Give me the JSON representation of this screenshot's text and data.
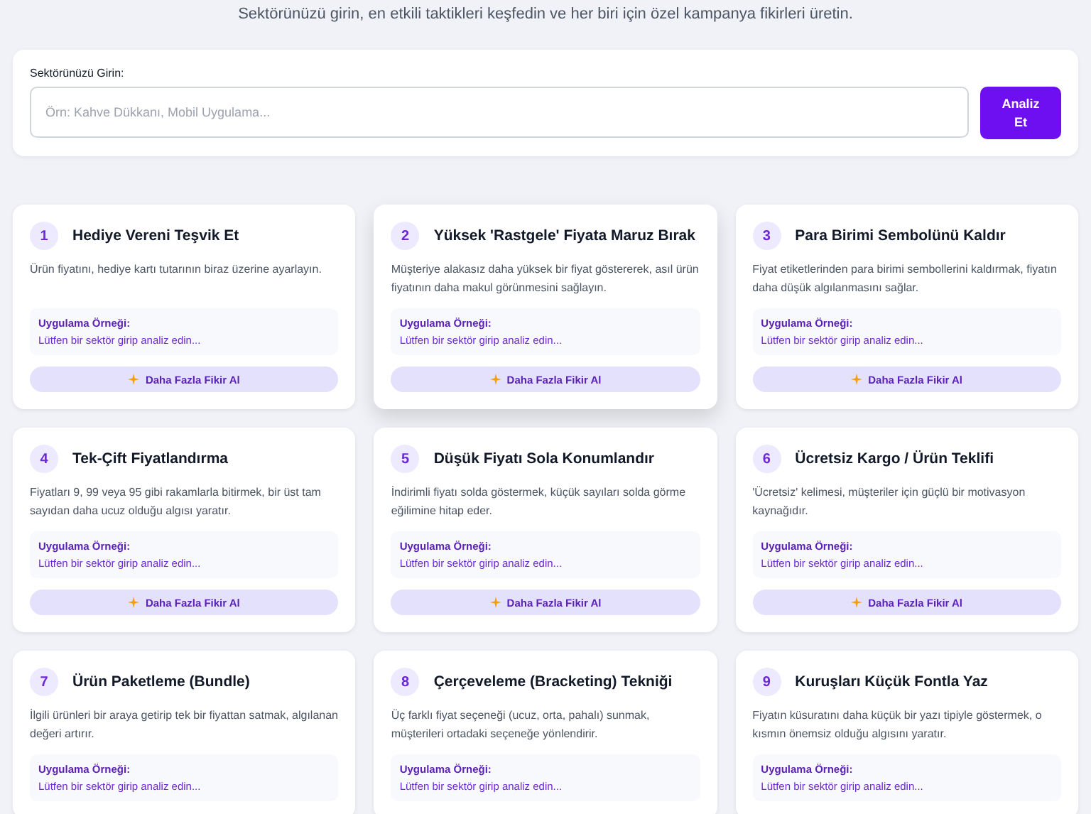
{
  "subtitle": "Sektörünüzü girin, en etkili taktikleri keşfedin ve her biri için özel kampanya fikirleri üretin.",
  "sector_form": {
    "label": "Sektörünüzü Girin:",
    "placeholder": "Örn: Kahve Dükkanı, Mobil Uygulama...",
    "button": "Analiz Et"
  },
  "tactics": [
    {
      "number": "1",
      "title": "Hediye Vereni Teşvik Et",
      "description": "Ürün fiyatını, hediye kartı tutarının biraz üzerine ayarlayın.",
      "example_label": "Uygulama Örneği:",
      "example_text": "Lütfen bir sektör girip analiz edin...",
      "button": "Daha Fazla Fikir Al",
      "elevated": false
    },
    {
      "number": "2",
      "title": "Yüksek 'Rastgele' Fiyata Maruz Bırak",
      "description": "Müşteriye alakasız daha yüksek bir fiyat göstererek, asıl ürün fiyatının daha makul görünmesini sağlayın.",
      "example_label": "Uygulama Örneği:",
      "example_text": "Lütfen bir sektör girip analiz edin...",
      "button": "Daha Fazla Fikir Al",
      "elevated": true
    },
    {
      "number": "3",
      "title": "Para Birimi Sembolünü Kaldır",
      "description": "Fiyat etiketlerinden para birimi sembollerini kaldırmak, fiyatın daha düşük algılanmasını sağlar.",
      "example_label": "Uygulama Örneği:",
      "example_text": "Lütfen bir sektör girip analiz edin...",
      "button": "Daha Fazla Fikir Al",
      "elevated": false
    },
    {
      "number": "4",
      "title": "Tek-Çift Fiyatlandırma",
      "description": "Fiyatları 9, 99 veya 95 gibi rakamlarla bitirmek, bir üst tam sayıdan daha ucuz olduğu algısı yaratır.",
      "example_label": "Uygulama Örneği:",
      "example_text": "Lütfen bir sektör girip analiz edin...",
      "button": "Daha Fazla Fikir Al",
      "elevated": false
    },
    {
      "number": "5",
      "title": "Düşük Fiyatı Sola Konumlandır",
      "description": "İndirimli fiyatı solda göstermek, küçük sayıları solda görme eğilimine hitap eder.",
      "example_label": "Uygulama Örneği:",
      "example_text": "Lütfen bir sektör girip analiz edin...",
      "button": "Daha Fazla Fikir Al",
      "elevated": false
    },
    {
      "number": "6",
      "title": "Ücretsiz Kargo / Ürün Teklifi",
      "description": "'Ücretsiz' kelimesi, müşteriler için güçlü bir motivasyon kaynağıdır.",
      "example_label": "Uygulama Örneği:",
      "example_text": "Lütfen bir sektör girip analiz edin...",
      "button": "Daha Fazla Fikir Al",
      "elevated": false
    },
    {
      "number": "7",
      "title": "Ürün Paketleme (Bundle)",
      "description": "İlgili ürünleri bir araya getirip tek bir fiyattan satmak, algılanan değeri artırır.",
      "example_label": "Uygulama Örneği:",
      "example_text": "Lütfen bir sektör girip analiz edin..."
    },
    {
      "number": "8",
      "title": "Çerçeveleme (Bracketing) Tekniği",
      "description": "Üç farklı fiyat seçeneği (ucuz, orta, pahalı) sunmak, müşterileri ortadaki seçeneğe yönlendirir.",
      "example_label": "Uygulama Örneği:",
      "example_text": "Lütfen bir sektör girip analiz edin..."
    },
    {
      "number": "9",
      "title": "Kuruşları Küçük Fontla Yaz",
      "description": "Fiyatın küsuratını daha küçük bir yazı tipiyle göstermek, o kısmın önemsiz olduğu algısını yaratır.",
      "example_label": "Uygulama Örneği:",
      "example_text": "Lütfen bir sektör girip analiz edin..."
    }
  ]
}
